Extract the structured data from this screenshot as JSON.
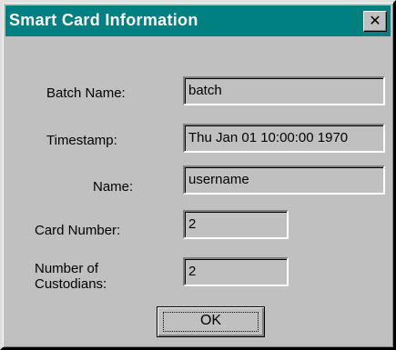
{
  "window": {
    "title": "Smart Card Information",
    "close_glyph": "✕",
    "close_icon": "close-icon"
  },
  "fields": {
    "batch_name": {
      "label": "Batch Name:",
      "value": "batch"
    },
    "timestamp": {
      "label": "Timestamp:",
      "value": "Thu Jan 01 10:00:00 1970"
    },
    "name": {
      "label": "Name:",
      "value": "username"
    },
    "card_number": {
      "label": "Card Number:",
      "value": "2"
    },
    "custodians": {
      "label_line1": "Number of",
      "label_line2": "Custodians:",
      "value": "2"
    }
  },
  "buttons": {
    "ok_label": "OK"
  },
  "colors": {
    "titlebar": "#008080",
    "face": "#c0c0c0"
  }
}
